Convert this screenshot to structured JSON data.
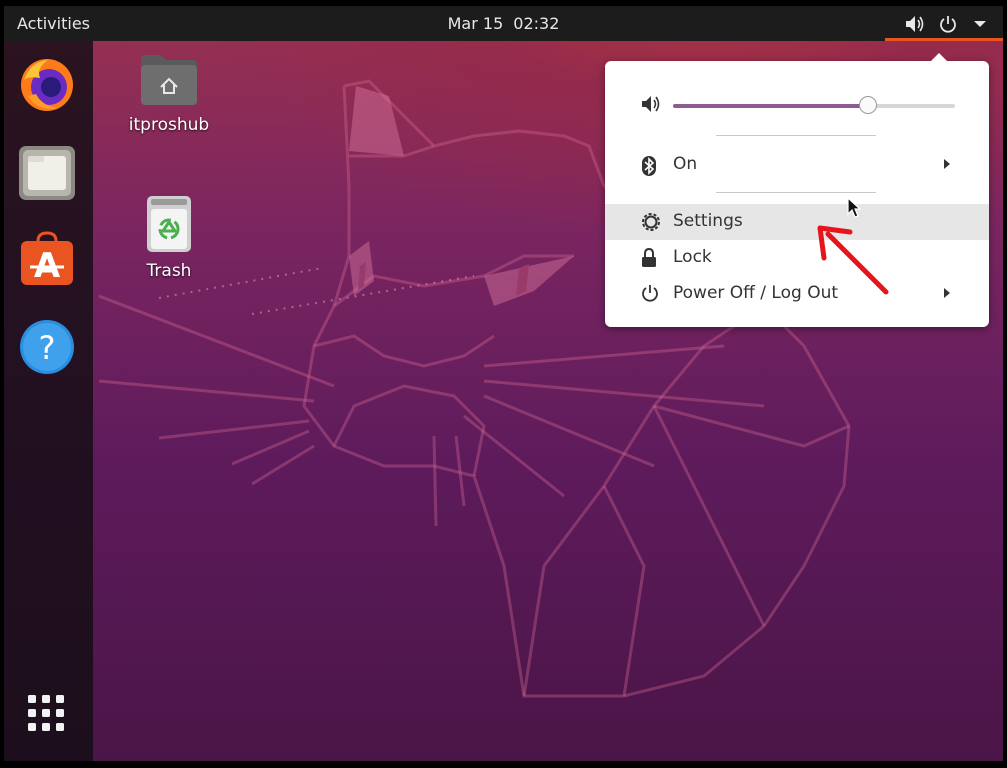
{
  "topbar": {
    "activities_label": "Activities",
    "date": "Mar 15",
    "time": "02:32",
    "accent_color": "#e95420"
  },
  "dock": {
    "items": [
      {
        "name": "firefox-icon"
      },
      {
        "name": "files-icon"
      },
      {
        "name": "software-center-icon"
      },
      {
        "name": "help-icon"
      },
      {
        "name": "show-applications-icon"
      }
    ]
  },
  "desktop": {
    "icons": [
      {
        "label": "itproshub",
        "icon": "home-folder-icon"
      },
      {
        "label": "Trash",
        "icon": "trash-icon"
      }
    ]
  },
  "menu": {
    "volume": {
      "level": 0.69,
      "icon": "speaker-icon"
    },
    "bluetooth": {
      "label": "On",
      "icon": "bluetooth-icon"
    },
    "settings": {
      "label": "Settings",
      "icon": "gear-icon"
    },
    "lock": {
      "label": "Lock",
      "icon": "lock-icon"
    },
    "power": {
      "label": "Power Off / Log Out",
      "icon": "power-icon"
    },
    "slider_fill_color": "#8e5c92"
  },
  "annotation": {
    "color": "#e8141b"
  }
}
